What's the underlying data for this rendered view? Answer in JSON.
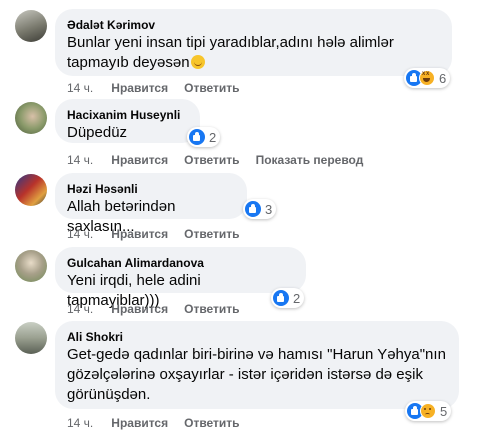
{
  "comments": [
    {
      "author": "Ədalət Kərimov",
      "text": "Bunlar yeni insan tipi yaradıblar,adını hələ alimlər tapmayıb deyəsən",
      "emoji": "grin-sweat-emoji",
      "reactions": [
        "like",
        "haha"
      ],
      "reaction_count": "6",
      "time": "14 ч.",
      "actions": [
        "Нравится",
        "Ответить"
      ],
      "avatar_color": "#7a7a6e"
    },
    {
      "author": "Hacixanim Huseynli",
      "text": "Düpedüz",
      "reactions": [
        "like"
      ],
      "reaction_count": "2",
      "time": "14 ч.",
      "actions": [
        "Нравится",
        "Ответить",
        "Показать перевод"
      ],
      "avatar_color": "#8a9a6a"
    },
    {
      "author": "Həzi Həsənli",
      "text": "Allah betərindən saxlasın...",
      "reactions": [
        "like"
      ],
      "reaction_count": "3",
      "time": "14 ч.",
      "actions": [
        "Нравится",
        "Ответить"
      ],
      "avatar_color": "#b8322a"
    },
    {
      "author": "Gulcahan Alimardanova",
      "text": "Yeni irqdi, hele adini tapmayiblar)))",
      "reactions": [
        "like"
      ],
      "reaction_count": "2",
      "time": "14 ч.",
      "actions": [
        "Нравится",
        "Ответить"
      ],
      "avatar_color": "#6f8a55"
    },
    {
      "author": "Ali Shokri",
      "text": "Get-gedə qadınlar biri-birinə və hamısı \"Harun Yəhya\"nın gözəlçələrinə oxşayırlar - istər içəridən istərsə də eşik görünüşdən.",
      "reactions": [
        "like",
        "sad"
      ],
      "reaction_count": "5",
      "time": "14 ч.",
      "actions": [
        "Нравится",
        "Ответить"
      ],
      "avatar_color": "#9aa090"
    }
  ]
}
